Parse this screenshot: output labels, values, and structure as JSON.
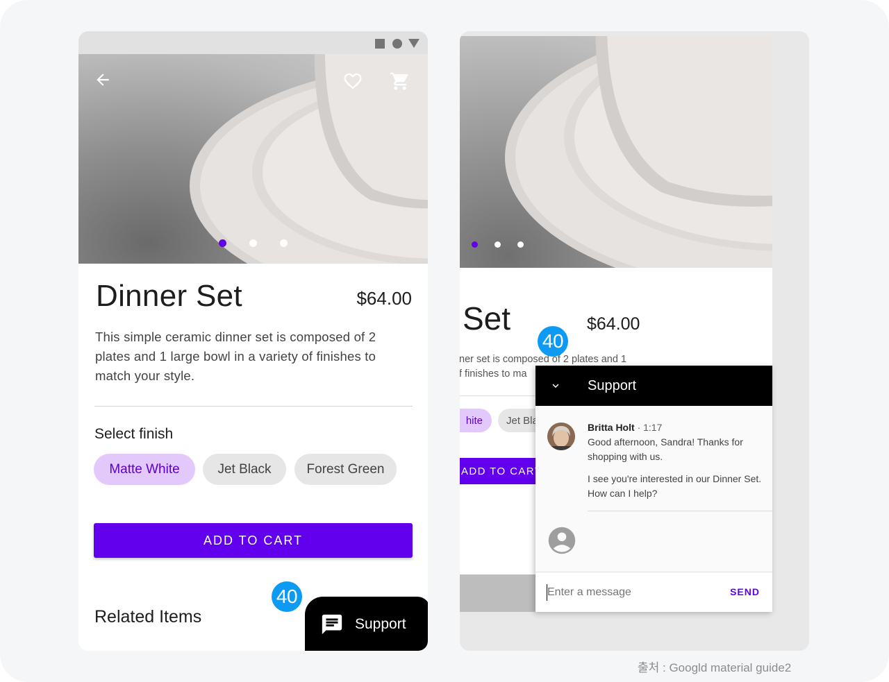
{
  "left_screen": {
    "product_title": "Dinner Set",
    "price": "$64.00",
    "description": "This simple ceramic dinner set is composed of 2 plates and 1 large bowl in a variety of finishes to match your style.",
    "select_finish_label": "Select finish",
    "finishes": [
      "Matte White",
      "Jet Black",
      "Forest Green"
    ],
    "selected_finish": "Matte White",
    "add_to_cart_label": "ADD TO CART",
    "related_items_label": "Related Items",
    "support_fab_label": "Support",
    "badge": "40"
  },
  "right_screen": {
    "product_title_partial": "Set",
    "price": "$64.00",
    "description_line1": "ner set is composed of 2 plates and 1",
    "description_line2": "f finishes to ma",
    "chip_selected_partial": "hite",
    "chip_partial": "Jet Bla",
    "add_to_cart_partial": "ADD TO CART",
    "badge": "40",
    "chat": {
      "title": "Support",
      "sender_name": "Britta Holt",
      "sender_time": "· 1:17",
      "message_1": "Good afternoon, Sandra! Thanks for shopping with us.",
      "message_2": "I see you're interested in our Dinner Set. How can I help?",
      "input_placeholder": "Enter a message",
      "send_label": "SEND"
    }
  },
  "caption": "출처 : Googld material guide2",
  "colors": {
    "primary": "#6200ee",
    "chip_selected_bg": "#e3c9fb",
    "badge": "#0d9af2",
    "support_bg": "#000000"
  },
  "icons": [
    "back-arrow-icon",
    "heart-icon",
    "cart-icon",
    "chat-icon",
    "chevron-down-icon",
    "person-icon"
  ],
  "carousel": {
    "pages": 3,
    "active_page": 1
  }
}
